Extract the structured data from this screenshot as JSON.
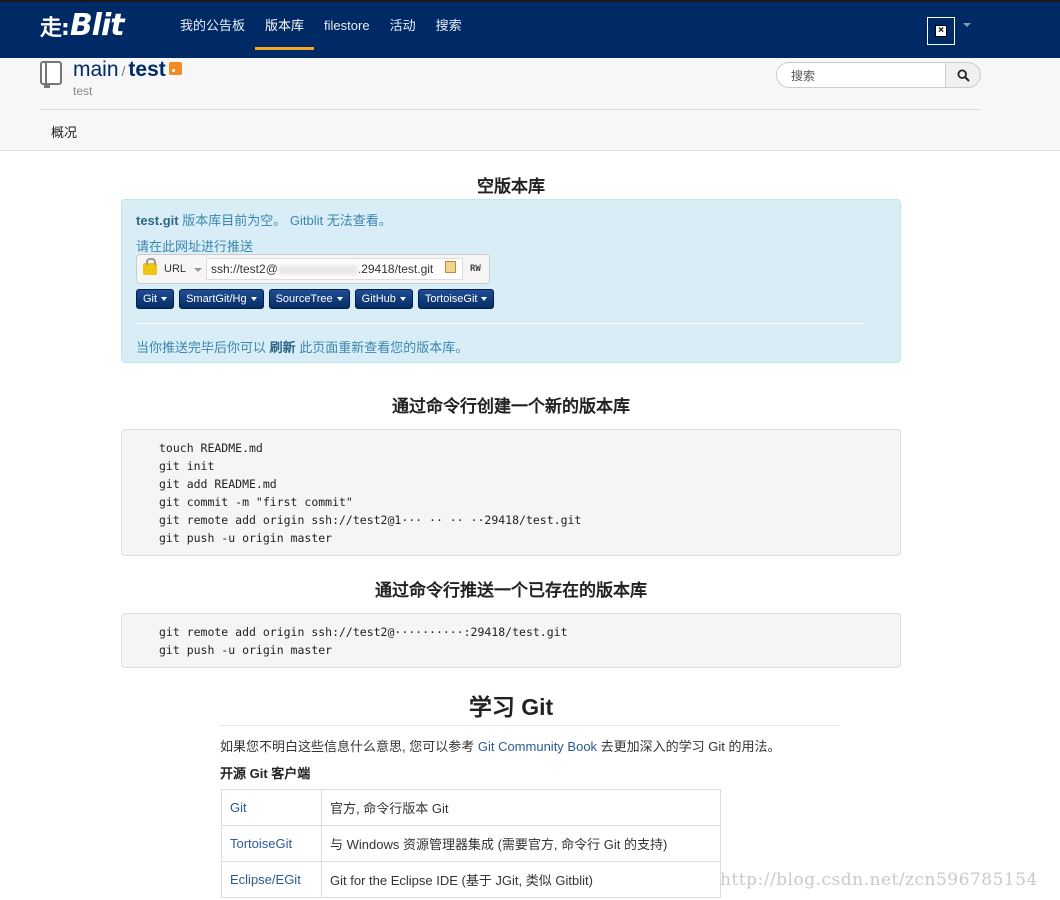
{
  "topbar": {
    "logo": "Blit",
    "logo_glyph": "走:",
    "nav": [
      "我的公告板",
      "版本库",
      "filestore",
      "活动",
      "搜索"
    ],
    "active_index": 1
  },
  "repo": {
    "group": "main",
    "name": "test",
    "description": "test"
  },
  "search": {
    "placeholder": "搜索"
  },
  "tabs": {
    "overview": "概况"
  },
  "empty": {
    "heading": "空版本库",
    "repo_name": "test.git",
    "repo_msg": " 版本库目前为空。 Gitblit 无法查看。",
    "push_hint": "请在此网址进行推送",
    "url_type": "URL",
    "url_prefix": "ssh://test2@",
    "url_suffix": ".29418/test.git",
    "access": "RW",
    "client_buttons": [
      "Git",
      "SmartGit/Hg",
      "SourceTree",
      "GitHub",
      "TortoiseGit"
    ],
    "after_pre": "当你推送完毕后你可以 ",
    "refresh": "刷新",
    "after_post": " 此页面重新查看您的版本库。"
  },
  "create": {
    "heading": "通过命令行创建一个新的版本库",
    "code": "touch README.md\ngit init\ngit add README.md\ngit commit -m \"first commit\"\ngit remote add origin ssh://test2@1··· ·· ·· ··29418/test.git\ngit push -u origin master"
  },
  "push_existing": {
    "heading": "通过命令行推送一个已存在的版本库",
    "code": "git remote add origin ssh://test2@··········:29418/test.git\ngit push -u origin master"
  },
  "learn": {
    "heading": "学习 Git",
    "text_pre": "如果您不明白这些信息什么意思, 您可以参考 ",
    "link": "Git Community Book",
    "text_post": " 去更加深入的学习 Git 的用法。",
    "clients_title": "开源 Git 客户端",
    "clients": [
      {
        "name": "Git",
        "desc": "官方, 命令行版本 Git"
      },
      {
        "name": "TortoiseGit",
        "desc": "与 Windows 资源管理器集成 (需要官方, 命令行 Git 的支持)"
      },
      {
        "name": "Eclipse/EGit",
        "desc": "Git for the Eclipse IDE (基于 JGit, 类似 Gitblit)"
      }
    ]
  },
  "watermark": "http://blog.csdn.net/zcn596785154"
}
